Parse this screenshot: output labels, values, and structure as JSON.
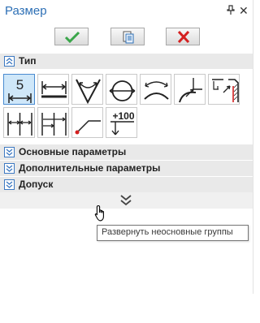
{
  "window": {
    "title": "Размер",
    "pin_glyph": "ᵖ",
    "close_glyph": "✕"
  },
  "actions": [
    {
      "name": "ok-button",
      "icon": "check-icon",
      "color": "#3aa64a"
    },
    {
      "name": "preview-button",
      "icon": "document-icon",
      "color": "#2c6fb5"
    },
    {
      "name": "cancel-button",
      "icon": "cross-icon",
      "color": "#d42020"
    }
  ],
  "sections": {
    "type": {
      "label": "Тип",
      "expanded": true
    },
    "main_params": {
      "label": "Основные параметры",
      "expanded": false
    },
    "extra_params": {
      "label": "Дополнительные параметры",
      "expanded": false
    },
    "tolerance": {
      "label": "Допуск",
      "expanded": false
    }
  },
  "type_buttons": [
    {
      "name": "linear-dimension",
      "text": "5",
      "selected": true
    },
    {
      "name": "aligned-dimension"
    },
    {
      "name": "angular-dimension"
    },
    {
      "name": "diameter-dimension"
    },
    {
      "name": "arc-dimension"
    },
    {
      "name": "radius-dimension"
    },
    {
      "name": "chamfer-dimension"
    },
    {
      "name": "chain-dimension"
    },
    {
      "name": "baseline-dimension"
    },
    {
      "name": "leader-dimension"
    },
    {
      "name": "elevation-dimension",
      "text": "+100"
    }
  ],
  "tooltip": {
    "text": "Развернуть неосновные группы"
  }
}
